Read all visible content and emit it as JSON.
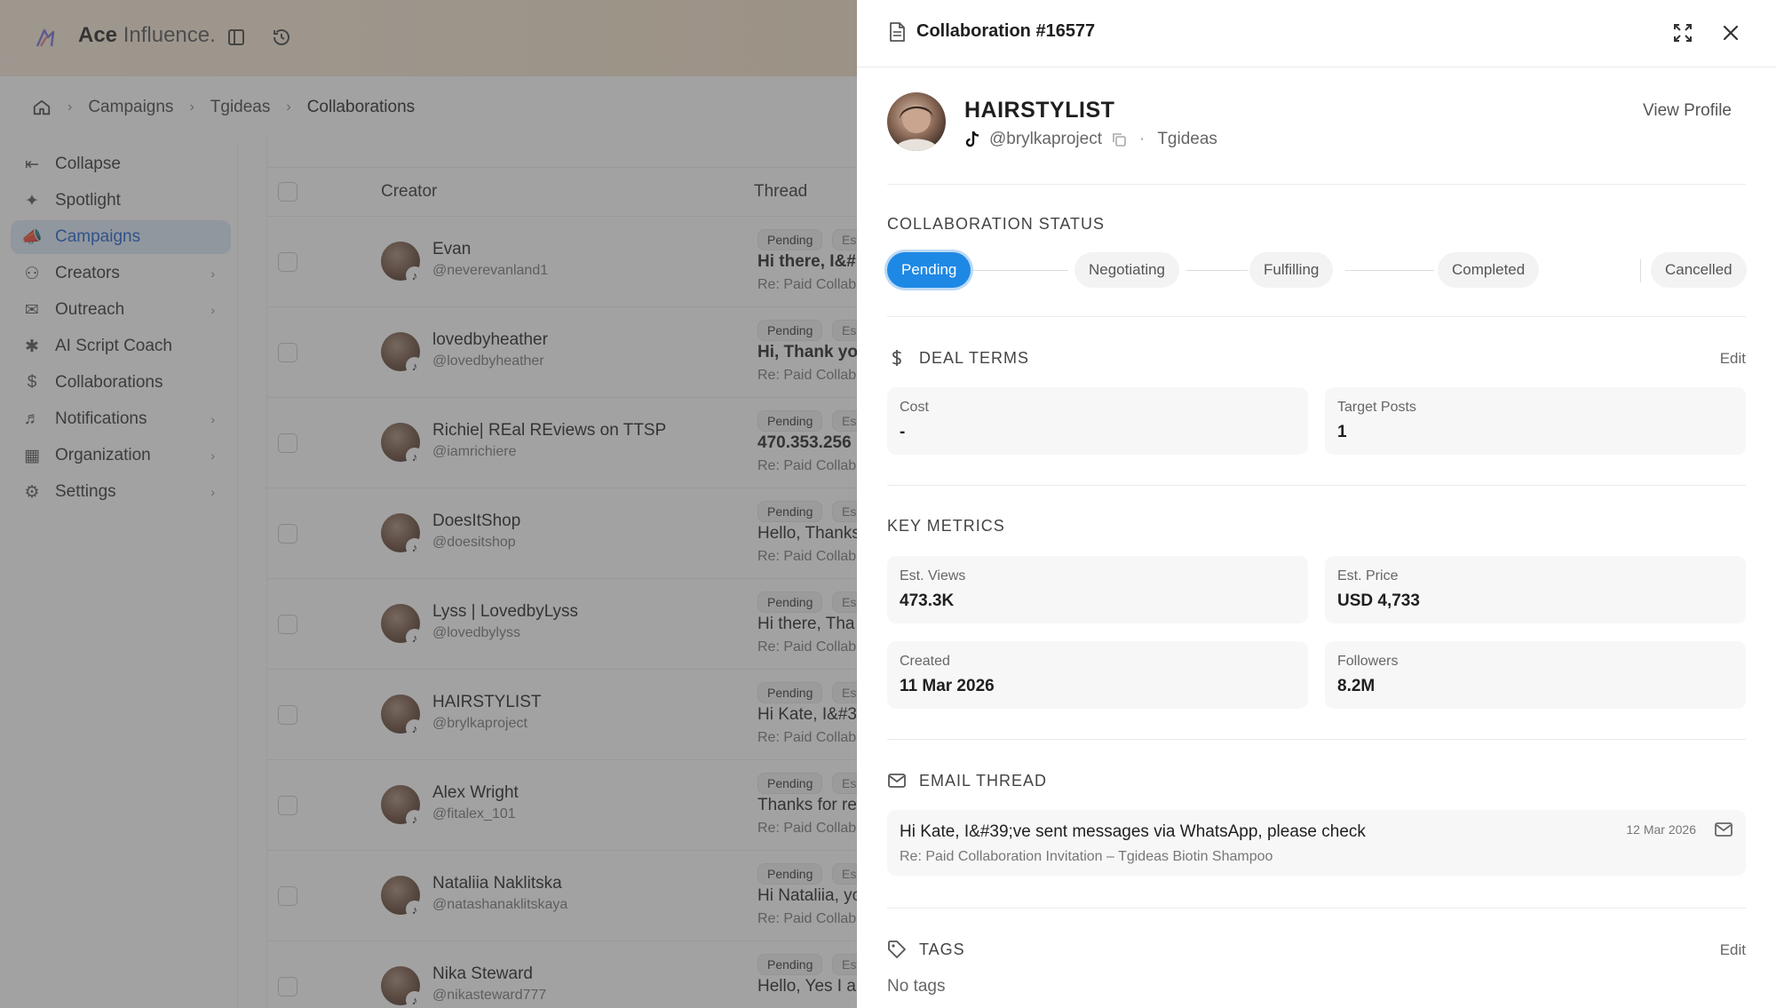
{
  "brand": {
    "name_bold": "Ace",
    "name_light": "Influence."
  },
  "breadcrumb": {
    "home": "home",
    "items": [
      "Campaigns",
      "Tgideas",
      "Collaborations"
    ]
  },
  "sidebar": {
    "items": [
      {
        "label": "Collapse",
        "icon": "collapse-icon"
      },
      {
        "label": "Spotlight",
        "icon": "sparkles-icon"
      },
      {
        "label": "Campaigns",
        "icon": "megaphone-icon",
        "active": true
      },
      {
        "label": "Creators",
        "icon": "users-icon",
        "chevron": true
      },
      {
        "label": "Outreach",
        "icon": "mail-icon",
        "chevron": true
      },
      {
        "label": "AI Script Coach",
        "icon": "wand-icon"
      },
      {
        "label": "Collaborations",
        "icon": "dollar-icon"
      },
      {
        "label": "Notifications",
        "icon": "bell-icon",
        "chevron": true
      },
      {
        "label": "Organization",
        "icon": "building-icon",
        "chevron": true
      },
      {
        "label": "Settings",
        "icon": "gear-icon",
        "chevron": true
      }
    ]
  },
  "table": {
    "headers": {
      "creator": "Creator",
      "thread": "Thread"
    },
    "rows": [
      {
        "name": "Evan",
        "handle": "@neverevanland1",
        "status": "Pending",
        "est": "Est",
        "msg": "Hi there, I&#",
        "re": "Re: Paid Collab",
        "bold": true
      },
      {
        "name": "lovedbyheather",
        "handle": "@lovedbyheather",
        "status": "Pending",
        "est": "Est",
        "msg": "Hi, Thank yo",
        "re": "Re: Paid Collab",
        "bold": true
      },
      {
        "name": "Richie| REal REviews on TTSP",
        "handle": "@iamrichiere",
        "status": "Pending",
        "est": "Est",
        "msg": "470.353.256",
        "re": "Re: Paid Collab",
        "bold": true
      },
      {
        "name": "DoesItShop",
        "handle": "@doesitshop",
        "status": "Pending",
        "est": "Est",
        "msg": "Hello, Thanks",
        "re": "Re: Paid Collab",
        "bold": false
      },
      {
        "name": "Lyss | LovedbyLyss",
        "handle": "@lovedbylyss",
        "status": "Pending",
        "est": "Est",
        "msg": "Hi there, Tha",
        "re": "Re: Paid Collab",
        "bold": false
      },
      {
        "name": "HAIRSTYLIST",
        "handle": "@brylkaproject",
        "status": "Pending",
        "est": "Est",
        "msg": "Hi Kate, I&#3",
        "re": "Re: Paid Collab",
        "bold": false
      },
      {
        "name": "Alex Wright",
        "handle": "@fitalex_101",
        "status": "Pending",
        "est": "Est",
        "msg": "Thanks for re",
        "re": "Re: Paid Collab",
        "bold": false
      },
      {
        "name": "Nataliia Naklitska",
        "handle": "@natashanaklitskaya",
        "status": "Pending",
        "est": "Est",
        "msg": "Hi Nataliia, yo",
        "re": "Re: Paid Collab",
        "bold": false
      },
      {
        "name": "Nika Steward",
        "handle": "@nikasteward777",
        "status": "Pending",
        "est": "Est",
        "msg": "Hello, Yes I ar",
        "re": "",
        "bold": false
      }
    ]
  },
  "drawer": {
    "title": "Collaboration #16577",
    "profile": {
      "name": "HAIRSTYLIST",
      "handle": "@brylkaproject",
      "campaign": "Tgideas",
      "view_profile": "View Profile"
    },
    "status": {
      "title": "COLLABORATION STATUS",
      "steps": [
        "Pending",
        "Negotiating",
        "Fulfilling",
        "Completed",
        "Cancelled"
      ],
      "current": "Pending"
    },
    "deal_terms": {
      "title": "DEAL TERMS",
      "edit": "Edit",
      "cost_label": "Cost",
      "cost_value": "-",
      "target_label": "Target Posts",
      "target_value": "1"
    },
    "metrics": {
      "title": "KEY METRICS",
      "views_label": "Est. Views",
      "views_value": "473.3K",
      "price_label": "Est. Price",
      "price_value": "USD 4,733",
      "created_label": "Created",
      "created_value": "11 Mar 2026",
      "followers_label": "Followers",
      "followers_value": "8.2M"
    },
    "email": {
      "title": "EMAIL THREAD",
      "subject": "Hi Kate, I&#39;ve sent messages via WhatsApp, please check",
      "re": "Re: Paid Collaboration Invitation – Tgideas Biotin Shampoo",
      "date": "12 Mar 2026"
    },
    "tags": {
      "title": "TAGS",
      "edit": "Edit",
      "empty": "No tags"
    }
  },
  "colors": {
    "accent": "#1e88e5",
    "active_bg": "#dde9f7"
  }
}
